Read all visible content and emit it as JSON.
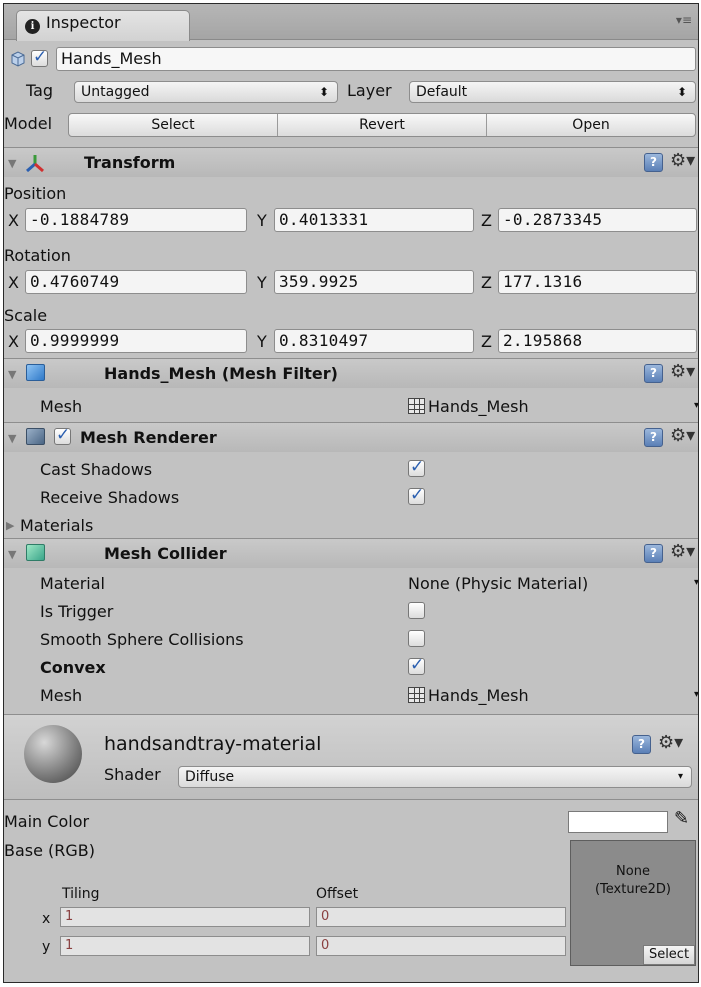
{
  "tab": {
    "title": "Inspector"
  },
  "object": {
    "name": "Hands_Mesh",
    "tag_label": "Tag",
    "tag_value": "Untagged",
    "layer_label": "Layer",
    "layer_value": "Default",
    "model_label": "Model",
    "model_buttons": [
      "Select",
      "Revert",
      "Open"
    ]
  },
  "transform": {
    "title": "Transform",
    "position_label": "Position",
    "rotation_label": "Rotation",
    "scale_label": "Scale",
    "axis_labels": [
      "X",
      "Y",
      "Z"
    ],
    "position": [
      "-0.1884789",
      "0.4013331",
      "-0.2873345"
    ],
    "rotation": [
      "0.4760749",
      "359.9925",
      "177.1316"
    ],
    "scale": [
      "0.9999999",
      "0.8310497",
      "2.195868"
    ]
  },
  "mesh_filter": {
    "title": "Hands_Mesh (Mesh Filter)",
    "mesh_label": "Mesh",
    "mesh_value": "Hands_Mesh"
  },
  "mesh_renderer": {
    "title": "Mesh Renderer",
    "cast_shadows_label": "Cast Shadows",
    "cast_shadows": true,
    "receive_shadows_label": "Receive Shadows",
    "receive_shadows": true,
    "materials_label": "Materials"
  },
  "mesh_collider": {
    "title": "Mesh Collider",
    "material_label": "Material",
    "material_value": "None (Physic Material)",
    "is_trigger_label": "Is Trigger",
    "is_trigger": false,
    "smooth_label": "Smooth Sphere Collisions",
    "smooth": false,
    "convex_label": "Convex",
    "convex": true,
    "mesh_label": "Mesh",
    "mesh_value": "Hands_Mesh"
  },
  "material": {
    "name": "handsandtray-material",
    "shader_label": "Shader",
    "shader_value": "Diffuse",
    "main_color_label": "Main Color",
    "base_label": "Base (RGB)",
    "texture_slot": "None\n(Texture2D)",
    "texture_select": "Select",
    "tiling_label": "Tiling",
    "offset_label": "Offset",
    "x_label": "x",
    "y_label": "y",
    "tiling_x": "1",
    "tiling_y": "1",
    "offset_x": "0",
    "offset_y": "0"
  },
  "colors": {
    "panel": "#c2c2c2",
    "header": "#b8b8b8",
    "check_blue": "#2b5fb0"
  }
}
